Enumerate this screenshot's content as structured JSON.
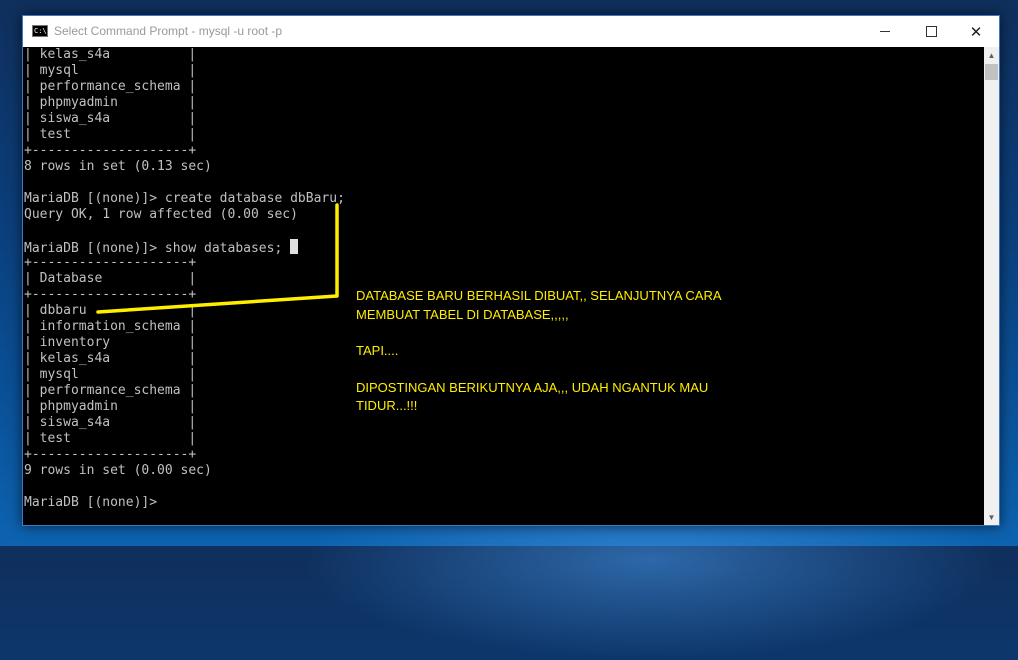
{
  "window": {
    "title": "Select Command Prompt - mysql  -u root -p",
    "icon_label": "C:\\",
    "controls": {
      "minimize": "minimize-icon",
      "maximize": "maximize-icon",
      "close": "close-icon"
    },
    "close_glyph": "✕"
  },
  "console": {
    "lines": [
      "| kelas_s4a          |",
      "| mysql              |",
      "| performance_schema |",
      "| phpmyadmin         |",
      "| siswa_s4a          |",
      "| test               |",
      "+--------------------+",
      "8 rows in set (0.13 sec)",
      "",
      "MariaDB [(none)]> create database dbBaru;",
      "Query OK, 1 row affected (0.00 sec)",
      "",
      "MariaDB [(none)]> show databases; ",
      "+--------------------+",
      "| Database           |",
      "+--------------------+",
      "| dbbaru             |",
      "| information_schema |",
      "| inventory          |",
      "| kelas_s4a          |",
      "| mysql              |",
      "| performance_schema |",
      "| phpmyadmin         |",
      "| siswa_s4a          |",
      "| test               |",
      "+--------------------+",
      "9 rows in set (0.00 sec)",
      "",
      "MariaDB [(none)]> "
    ],
    "colors": {
      "text": "#c0c0c0",
      "background": "#000000"
    }
  },
  "annotation": {
    "line1": "DATABASE BARU BERHASIL DIBUAT,, SELANJUTNYA CARA",
    "line2": "MEMBUAT TABEL DI DATABASE,,,,,",
    "line3": "TAPI....",
    "line4": "DIPOSTINGAN BERIKUTNYA AJA,,, UDAH NGANTUK MAU",
    "line5": "TIDUR...!!!",
    "color": "#ffee00"
  },
  "scrollbar": {
    "up_glyph": "▲",
    "down_glyph": "▼"
  }
}
